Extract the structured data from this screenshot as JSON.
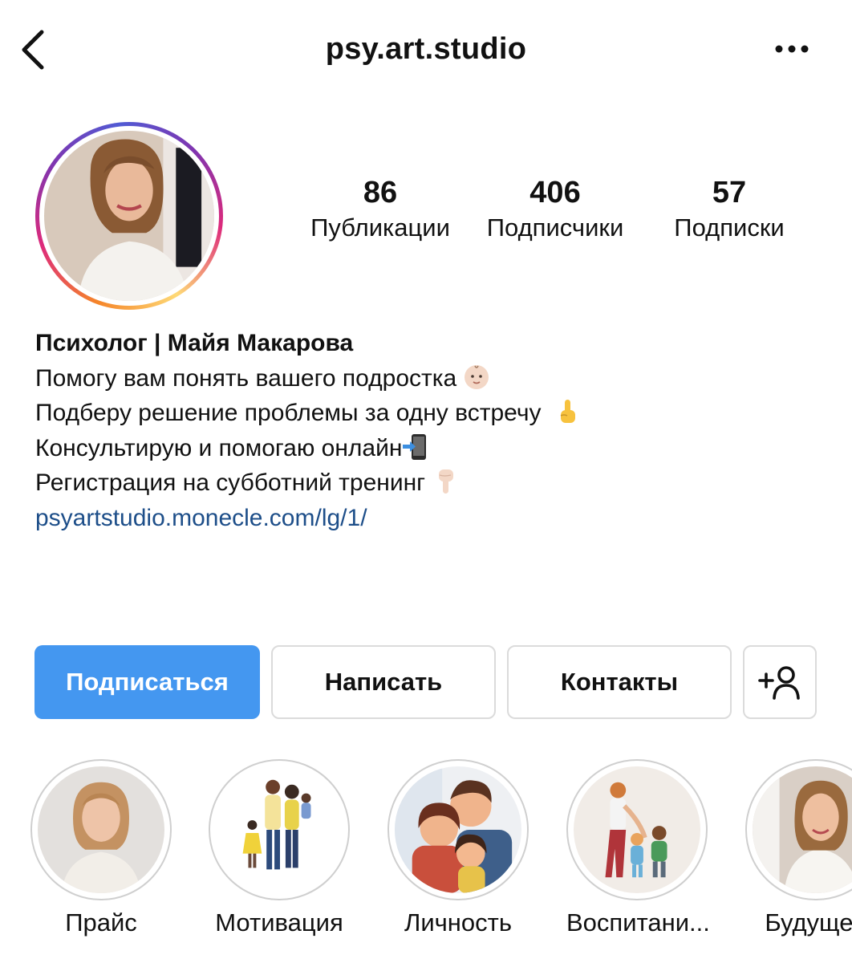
{
  "header": {
    "username": "psy.art.studio",
    "back_icon": "chevron-left-icon",
    "more_icon": "more-horizontal-icon"
  },
  "stats": {
    "posts": {
      "value": "86",
      "label": "Публикации"
    },
    "followers": {
      "value": "406",
      "label": "Подписчики"
    },
    "following": {
      "value": "57",
      "label": "Подписки"
    }
  },
  "bio": {
    "name": "Психолог | Майя Макарова",
    "lines": [
      {
        "text": "Помогу вам понять вашего подростка",
        "icon": "baby-face-icon"
      },
      {
        "text": "Подберу решение проблемы за одну встречу",
        "icon": "index-pointing-up-icon"
      },
      {
        "text": "Консультирую и помогаю онлайн",
        "icon": "mobile-phone-arrow-icon"
      },
      {
        "text": "Регистрация на субботний тренинг",
        "icon": "backhand-index-pointing-down-icon"
      }
    ],
    "link": "psyartstudio.monecle.com/lg/1/"
  },
  "actions": {
    "follow": "Подписаться",
    "message": "Написать",
    "contacts": "Контакты",
    "add_user_icon": "add-user-icon"
  },
  "highlights": [
    {
      "label": "Прайс"
    },
    {
      "label": "Мотивация"
    },
    {
      "label": "Личность"
    },
    {
      "label": "Воспитани..."
    },
    {
      "label": "Будущее"
    }
  ],
  "colors": {
    "primary_button": "#4497f0",
    "link": "#1d4e89",
    "border": "#dbdbdb"
  }
}
